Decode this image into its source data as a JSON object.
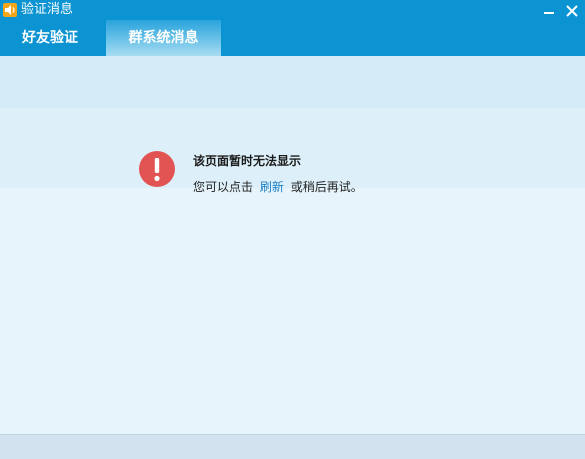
{
  "window": {
    "title": "验证消息",
    "app_icon": "speaker-icon",
    "minimize_icon": "minimize-icon",
    "close_icon": "close-icon"
  },
  "tabs": [
    {
      "label": "好友验证",
      "selected": false
    },
    {
      "label": "群系统消息",
      "selected": true
    }
  ],
  "error": {
    "icon": "exclamation-icon",
    "title": "该页面暂时无法显示",
    "message_before": "您可以点击",
    "refresh_link": "刷新",
    "message_after": "或稍后再试。"
  },
  "colors": {
    "titlebar": "#0b93d2",
    "content_bg": "#e7f4fb",
    "error_red": "#e25454",
    "link_blue": "#1a7fc9"
  }
}
